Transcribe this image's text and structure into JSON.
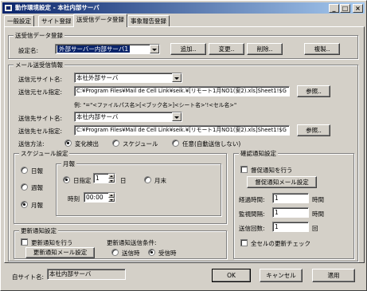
{
  "window": {
    "title": "動作環境設定 - 本社内部サーバ",
    "minimize_glyph": "_",
    "maximize_glyph": "□",
    "close_glyph": "×"
  },
  "tabs": [
    {
      "label": "一般設定"
    },
    {
      "label": "サイト登録"
    },
    {
      "label": "送受信データ登録"
    },
    {
      "label": "事象報告登録"
    }
  ],
  "send_data": {
    "legend": "送受信データ登録",
    "setting_name_label": "設定名:",
    "setting_name_value": "外部サーバー内部サーバ1",
    "add_button": "追加..",
    "change_button": "変更..",
    "delete_button": "削除..",
    "copy_button": "複製.."
  },
  "mail": {
    "legend": "メール送受信情報",
    "source_site_label": "送信元サイト名:",
    "source_site_value": "本社外部サーバ",
    "source_cell_label": "送信元セル指定:",
    "source_cell_value": "C:¥Program Files¥Mail de Cell Link¥seik.¥[リモート1月NO1(案2).xls]Sheet1!$G",
    "browse_button_1": "参照..",
    "example_text": "例: \"=\"<ファイルパス名>[<ブック名>]<シート名>'!<セル名>\"",
    "dest_site_label": "送信先サイト名:",
    "dest_site_value": "本社内部サーバ",
    "dest_cell_label": "送信先セル指定:",
    "dest_cell_value": "C:¥Program Files¥Mail de Cell Link¥seik.¥[リモート1月NO1(案2).xls]Sheet1!$G",
    "browse_button_2": "参照..",
    "method_label": "送信方法:",
    "method_options": [
      {
        "label": "変化検出",
        "selected": true
      },
      {
        "label": "スケジュール",
        "selected": false
      },
      {
        "label": "任意(自動送信しない)",
        "selected": false
      }
    ]
  },
  "schedule": {
    "legend": "スケジュール設定",
    "period_options": [
      {
        "label": "日報",
        "selected": false
      },
      {
        "label": "週報",
        "selected": false
      },
      {
        "label": "月報",
        "selected": true
      }
    ],
    "monthly_legend": "月報",
    "day_specified_label": "日指定",
    "day_value": "1",
    "day_unit": "日",
    "month_end_label": "月末",
    "time_label": "時刻",
    "time_value": "00:00"
  },
  "update_notify": {
    "legend": "更新通知設定",
    "enable_label": "更新通知を行う",
    "mail_setting_button": "更新通知メール設定",
    "condition_label": "更新通知送信条件:",
    "condition_options": [
      {
        "label": "送信時",
        "selected": false
      },
      {
        "label": "受信時",
        "selected": true
      }
    ]
  },
  "confirm_notify": {
    "legend": "確認通知設定",
    "enable_label": "督促通知を行う",
    "mail_setting_button": "督促通知メール設定",
    "elapsed_label": "経過時間:",
    "elapsed_value": "1",
    "elapsed_unit": "時間",
    "interval_label": "監視間隔:",
    "interval_value": "1",
    "interval_unit": "時間",
    "count_label": "送信回数:",
    "count_value": "1",
    "count_unit": "回",
    "all_cells_label": "全セルの更新チェック"
  },
  "footer": {
    "own_site_label": "自サイト名:",
    "own_site_value": "本社内部サーバ",
    "ok_button": "OK",
    "cancel_button": "キャンセル",
    "apply_button": "適用"
  }
}
